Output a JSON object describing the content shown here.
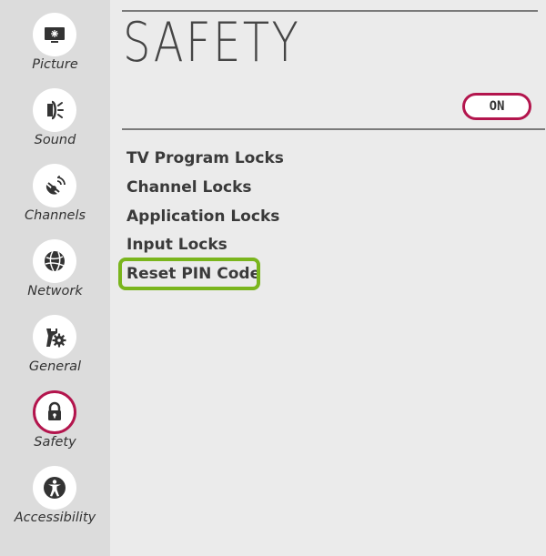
{
  "sidebar": {
    "items": [
      {
        "label": "Picture",
        "icon": "picture-icon"
      },
      {
        "label": "Sound",
        "icon": "sound-icon"
      },
      {
        "label": "Channels",
        "icon": "channels-icon"
      },
      {
        "label": "Network",
        "icon": "network-icon"
      },
      {
        "label": "General",
        "icon": "general-icon"
      },
      {
        "label": "Safety",
        "icon": "lock-icon",
        "active": true
      },
      {
        "label": "Accessibility",
        "icon": "accessibility-icon"
      }
    ]
  },
  "main": {
    "title": "SAFETY",
    "toggle_label": "ON",
    "menu": [
      {
        "label": "TV Program Locks"
      },
      {
        "label": "Channel Locks"
      },
      {
        "label": "Application Locks"
      },
      {
        "label": "Input Locks"
      },
      {
        "label": "Reset PIN Code",
        "highlighted": true
      }
    ]
  },
  "colors": {
    "sidebar_bg": "#dcdcdc",
    "main_bg": "#ebebeb",
    "accent": "#b3154d",
    "highlight": "#7ab51d",
    "text": "#3a3a3a"
  }
}
